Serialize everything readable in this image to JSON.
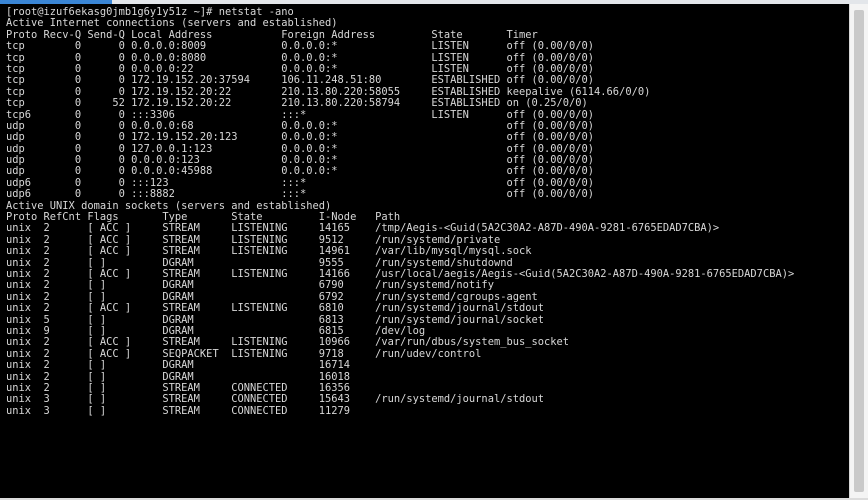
{
  "terminal": {
    "lines": [
      "[root@izuf6ekasg0jmb1g6y1y51z ~]# netstat -ano",
      "Active Internet connections (servers and established)",
      "Proto Recv-Q Send-Q Local Address           Foreign Address         State       Timer",
      "tcp        0      0 0.0.0.0:8009            0.0.0.0:*               LISTEN      off (0.00/0/0)",
      "tcp        0      0 0.0.0.0:8080            0.0.0.0:*               LISTEN      off (0.00/0/0)",
      "tcp        0      0 0.0.0.0:22              0.0.0.0:*               LISTEN      off (0.00/0/0)",
      "tcp        0      0 172.19.152.20:37594     106.11.248.51:80        ESTABLISHED off (0.00/0/0)",
      "tcp        0      0 172.19.152.20:22        210.13.80.220:58055     ESTABLISHED keepalive (6114.66/0/0)",
      "tcp        0     52 172.19.152.20:22        210.13.80.220:58794     ESTABLISHED on (0.25/0/0)",
      "tcp6       0      0 :::3306                 :::*                    LISTEN      off (0.00/0/0)",
      "udp        0      0 0.0.0.0:68              0.0.0.0:*                           off (0.00/0/0)",
      "udp        0      0 172.19.152.20:123       0.0.0.0:*                           off (0.00/0/0)",
      "udp        0      0 127.0.0.1:123           0.0.0.0:*                           off (0.00/0/0)",
      "udp        0      0 0.0.0.0:123             0.0.0.0:*                           off (0.00/0/0)",
      "udp        0      0 0.0.0.0:45988           0.0.0.0:*                           off (0.00/0/0)",
      "udp6       0      0 :::123                  :::*                                off (0.00/0/0)",
      "udp6       0      0 :::8882                 :::*                                off (0.00/0/0)",
      "Active UNIX domain sockets (servers and established)",
      "Proto RefCnt Flags       Type       State         I-Node   Path",
      "unix  2      [ ACC ]     STREAM     LISTENING     14165    /tmp/Aegis-<Guid(5A2C30A2-A87D-490A-9281-6765EDAD7CBA)>",
      "unix  2      [ ACC ]     STREAM     LISTENING     9512     /run/systemd/private",
      "unix  2      [ ACC ]     STREAM     LISTENING     14961    /var/lib/mysql/mysql.sock",
      "unix  2      [ ]         DGRAM                    9555     /run/systemd/shutdownd",
      "unix  2      [ ACC ]     STREAM     LISTENING     14166    /usr/local/aegis/Aegis-<Guid(5A2C30A2-A87D-490A-9281-6765EDAD7CBA)>",
      "unix  2      [ ]         DGRAM                    6790     /run/systemd/notify",
      "unix  2      [ ]         DGRAM                    6792     /run/systemd/cgroups-agent",
      "unix  2      [ ACC ]     STREAM     LISTENING     6810     /run/systemd/journal/stdout",
      "unix  5      [ ]         DGRAM                    6813     /run/systemd/journal/socket",
      "unix  9      [ ]         DGRAM                    6815     /dev/log",
      "unix  2      [ ACC ]     STREAM     LISTENING     10966    /var/run/dbus/system_bus_socket",
      "unix  2      [ ACC ]     SEQPACKET  LISTENING     9718     /run/udev/control",
      "unix  2      [ ]         DGRAM                    16714",
      "unix  2      [ ]         DGRAM                    16018",
      "unix  2      [ ]         STREAM     CONNECTED     16356",
      "unix  3      [ ]         STREAM     CONNECTED     15643    /run/systemd/journal/stdout",
      "unix  3      [ ]         STREAM     CONNECTED     11279"
    ]
  }
}
